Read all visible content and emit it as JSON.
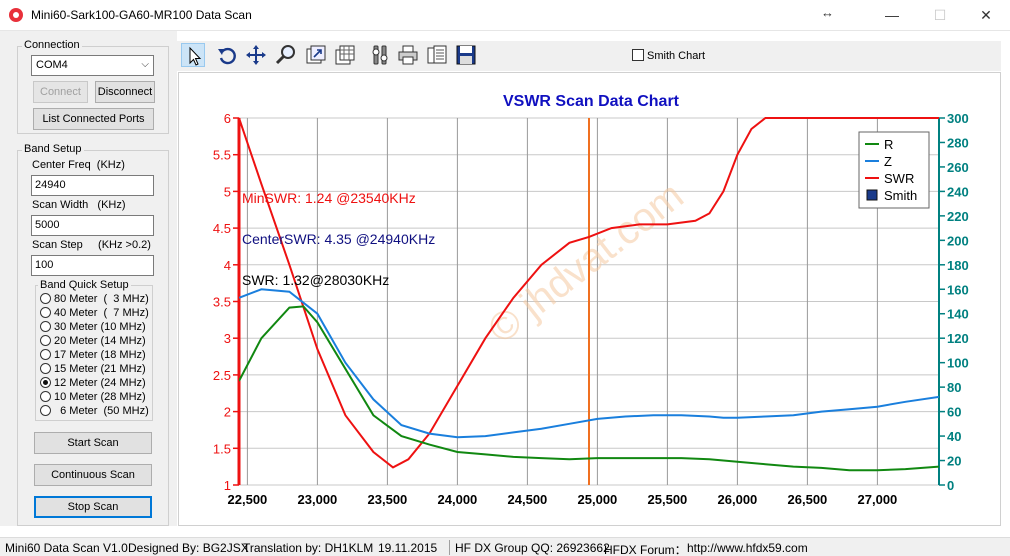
{
  "window": {
    "title": "Mini60-Sark100-GA60-MR100 Data Scan",
    "minimize": "—",
    "maximize": "☐",
    "close": "✕"
  },
  "connection": {
    "group_label": "Connection",
    "port": "COM4",
    "connect_label": "Connect",
    "disconnect_label": "Disconnect",
    "list_ports_label": "List Connected Ports"
  },
  "band_setup": {
    "group_label": "Band Setup",
    "center_freq_label": "Center Freq  (KHz)",
    "center_freq_value": "24940",
    "scan_width_label": "Scan Width   (KHz)",
    "scan_width_value": "5000",
    "scan_step_label": "Scan Step     (KHz >0.2)",
    "scan_step_value": "100",
    "quick_label": "Band Quick Setup",
    "bands": [
      {
        "label": "80 Meter  (  3 MHz)",
        "selected": false
      },
      {
        "label": "40 Meter  (  7 MHz)",
        "selected": false
      },
      {
        "label": "30 Meter (10 MHz)",
        "selected": false
      },
      {
        "label": "20 Meter (14 MHz)",
        "selected": false
      },
      {
        "label": "17 Meter (18 MHz)",
        "selected": false
      },
      {
        "label": "15 Meter (21 MHz)",
        "selected": false
      },
      {
        "label": "12 Meter (24 MHz)",
        "selected": true
      },
      {
        "label": "10 Meter (28 MHz)",
        "selected": false
      },
      {
        "label": "  6 Meter  (50 MHz)",
        "selected": false
      }
    ]
  },
  "actions": {
    "start_label": "Start Scan",
    "continuous_label": "Continuous Scan",
    "stop_label": "Stop Scan"
  },
  "toolbar": {
    "tools": [
      "pointer-icon",
      "undo-icon",
      "move-icon",
      "zoom-icon",
      "export-icon",
      "table-icon",
      "settings-icon",
      "print-icon",
      "copy-icon",
      "save-icon"
    ],
    "smith_chart_label": "Smith Chart",
    "smith_chart_checked": false
  },
  "watermark": "© jhdvat.com",
  "status": {
    "version": "Mini60 Data Scan V1.0",
    "designer": "Designed By: BG2JSX",
    "translation": "Translation by: DH1KLM",
    "date": "19.11.2015",
    "group": "HF DX Group QQ: 26923662",
    "forum": "HFDX Forum：",
    "url": "http://www.hfdx59.com"
  },
  "colors": {
    "title": "#1010c0",
    "swr": "#ee1111",
    "r": "#118811",
    "z": "#1a7fdd",
    "right_axis": "#008080",
    "marker": "#f07020"
  },
  "chart_data": {
    "type": "line",
    "title": "VSWR Scan Data Chart",
    "x_ticks": [
      22500,
      23000,
      23500,
      24000,
      24500,
      25000,
      25500,
      26000,
      26500,
      27000
    ],
    "x_tick_labels": [
      "22,500",
      "23,000",
      "23,500",
      "24,000",
      "24,500",
      "25,000",
      "25,500",
      "26,000",
      "26,500",
      "27,000"
    ],
    "xlim": [
      22440,
      27440
    ],
    "left_axis": {
      "ylim": [
        1,
        6
      ],
      "ticks": [
        1,
        1.5,
        2,
        2.5,
        3,
        3.5,
        4,
        4.5,
        5,
        5.5,
        6
      ],
      "tick_labels": [
        "1",
        "1.5",
        "2",
        "2.5",
        "3",
        "3.5",
        "4",
        "4.5",
        "5",
        "5.5",
        "6"
      ]
    },
    "right_axis": {
      "ylim": [
        0,
        300
      ],
      "ticks": [
        0,
        20,
        40,
        60,
        80,
        100,
        120,
        140,
        160,
        180,
        200,
        220,
        240,
        260,
        280,
        300
      ],
      "tick_labels": [
        "0",
        "20",
        "40",
        "60",
        "80",
        "100",
        "120",
        "140",
        "160",
        "180",
        "200",
        "220",
        "240",
        "260",
        "280",
        "300"
      ]
    },
    "legend": {
      "position": "top-right",
      "entries": [
        "R",
        "Z",
        "SWR",
        "Smith"
      ]
    },
    "grid": true,
    "marker_x": 24940,
    "annotations": [
      {
        "text": "MinSWR: 1.24 @23540KHz",
        "color": "#ee1111"
      },
      {
        "text": "CenterSWR: 4.35 @24940KHz",
        "color": "#101080"
      },
      {
        "text": "SWR: 1.32@28030KHz",
        "color": "#000000"
      }
    ],
    "series": [
      {
        "name": "SWR",
        "axis": "left",
        "x": [
          22440,
          22600,
          22800,
          23000,
          23200,
          23400,
          23540,
          23650,
          23800,
          24000,
          24200,
          24400,
          24600,
          24800,
          24940,
          25100,
          25300,
          25500,
          25700,
          25800,
          25900,
          26000,
          26100,
          26200,
          27440
        ],
        "y": [
          6.0,
          5.1,
          4.0,
          2.85,
          1.95,
          1.45,
          1.24,
          1.35,
          1.7,
          2.35,
          3.0,
          3.55,
          4.0,
          4.3,
          4.38,
          4.5,
          4.55,
          4.55,
          4.6,
          4.7,
          5.0,
          5.5,
          5.85,
          6.0,
          6.0
        ]
      },
      {
        "name": "R",
        "axis": "right",
        "x": [
          22440,
          22600,
          22800,
          22900,
          23000,
          23200,
          23400,
          23600,
          23800,
          24000,
          24200,
          24400,
          24600,
          24800,
          25000,
          25200,
          25400,
          25600,
          25800,
          26000,
          26200,
          26400,
          26600,
          26800,
          27000,
          27200,
          27440
        ],
        "y": [
          85,
          120,
          145,
          146,
          133,
          95,
          57,
          40,
          33,
          27,
          25,
          23,
          22,
          21,
          22,
          22,
          22,
          22,
          21,
          19,
          17,
          15,
          14,
          12,
          12,
          13,
          15
        ]
      },
      {
        "name": "Z",
        "axis": "right",
        "x": [
          22440,
          22600,
          22800,
          23000,
          23200,
          23400,
          23600,
          23800,
          24000,
          24200,
          24400,
          24600,
          24800,
          25000,
          25200,
          25400,
          25600,
          25800,
          25900,
          26000,
          26200,
          26400,
          26600,
          26800,
          27000,
          27200,
          27440
        ],
        "y": [
          153,
          160,
          158,
          140,
          100,
          70,
          49,
          42,
          39,
          40,
          43,
          46,
          50,
          54,
          56,
          57,
          57,
          56,
          55,
          55,
          56,
          57,
          60,
          62,
          64,
          68,
          72
        ]
      }
    ]
  }
}
